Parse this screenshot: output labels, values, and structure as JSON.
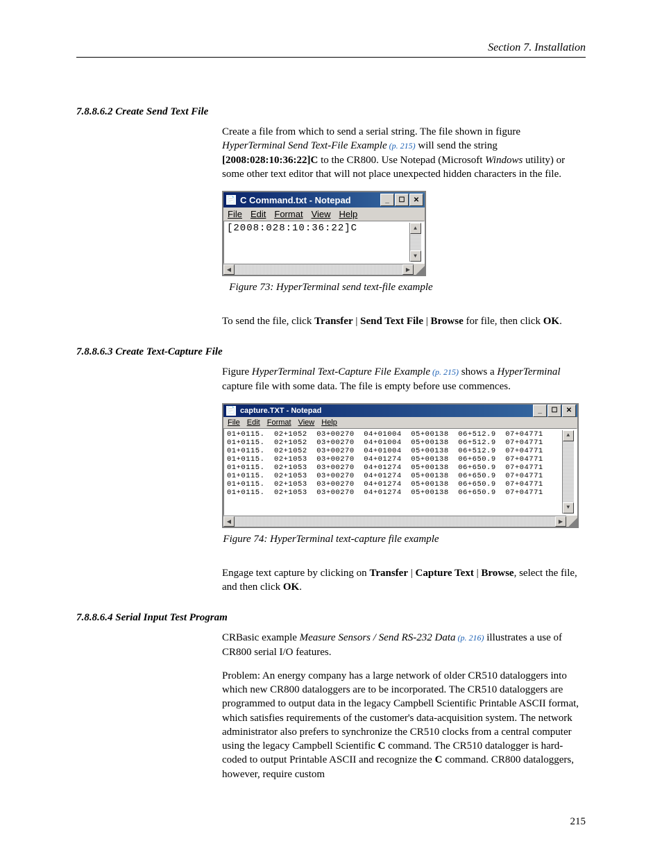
{
  "header": "Section 7.  Installation",
  "page_number": "215",
  "section1": {
    "heading": "7.8.8.6.2 Create Send Text File",
    "para_parts": {
      "p1": "Create a file from which to send a serial string. The file shown in figure ",
      "p2_italic": "HyperTerminal Send Text-File Example",
      "p3_ref": " (p. 215)",
      "p4": " will send the string ",
      "p5_bold": "[2008:028:10:36:22]C",
      "p6": " to the CR800. Use Notepad (Microsoft ",
      "p7_italic": "Windows",
      "p8": " utility) or some other text editor that will not place unexpected hidden characters in the file."
    }
  },
  "notepad_small": {
    "title": "C Command.txt - Notepad",
    "menus": [
      "File",
      "Edit",
      "Format",
      "View",
      "Help"
    ],
    "content": "[2008:028:10:36:22]C"
  },
  "fig73_caption": "Figure 73: HyperTerminal send text-file example",
  "para2_parts": {
    "p1": "To send the file, click ",
    "b1": "Transfer",
    "sep1": " | ",
    "b2": "Send Text File",
    "sep2": " | ",
    "b3": "Browse",
    "p2": " for file, then click ",
    "b4": "OK",
    "p3": "."
  },
  "section2": {
    "heading": "7.8.8.6.3 Create Text-Capture File",
    "para_parts": {
      "p1": "Figure ",
      "i1": "HyperTerminal Text-Capture File Example",
      "ref": " (p. 215)",
      "p2": " shows a ",
      "i2": "HyperTerminal",
      "p3": " capture file with some data. The file is empty before use commences."
    }
  },
  "notepad_large": {
    "title": "capture.TXT - Notepad",
    "menus": [
      "File",
      "Edit",
      "Format",
      "View",
      "Help"
    ],
    "rows": [
      "01+0115.  02+1052  03+00270  04+01004  05+00138  06+512.9  07+04771",
      "01+0115.  02+1052  03+00270  04+01004  05+00138  06+512.9  07+04771",
      "01+0115.  02+1052  03+00270  04+01004  05+00138  06+512.9  07+04771",
      "01+0115.  02+1053  03+00270  04+01274  05+00138  06+650.9  07+04771",
      "01+0115.  02+1053  03+00270  04+01274  05+00138  06+650.9  07+04771",
      "01+0115.  02+1053  03+00270  04+01274  05+00138  06+650.9  07+04771",
      "01+0115.  02+1053  03+00270  04+01274  05+00138  06+650.9  07+04771",
      "01+0115.  02+1053  03+00270  04+01274  05+00138  06+650.9  07+04771"
    ]
  },
  "fig74_caption": "Figure 74: HyperTerminal text-capture file example",
  "para3_parts": {
    "p1": "Engage text capture by clicking on ",
    "b1": "Transfer",
    "sep1": " | ",
    "b2": "Capture Text",
    "sep2": " | ",
    "b3": "Browse",
    "p2": ", select the file, and then click ",
    "b4": "OK",
    "p3": "."
  },
  "section3": {
    "heading": "7.8.8.6.4 Serial Input Test Program",
    "para1": {
      "p1": "CRBasic example ",
      "i1": "Measure Sensors / Send RS-232 Data",
      "ref": " (p. 216)",
      "p2": " illustrates a use of CR800 serial I/O features."
    },
    "para2": {
      "p1": "Problem: An energy company has a large network of older CR510 dataloggers into which new CR800 dataloggers are to be incorporated. The CR510 dataloggers are programmed to output data in the legacy Campbell Scientific Printable ASCII format, which satisfies requirements of the customer's data-acquisition system. The network administrator also prefers to synchronize the CR510 clocks from a central computer using the legacy Campbell Scientific ",
      "b1": "C",
      "p2": " command. The CR510 datalogger is hard-coded to output Printable ASCII and recognize the ",
      "b2": "C",
      "p3": " command. CR800 dataloggers, however, require custom"
    }
  }
}
